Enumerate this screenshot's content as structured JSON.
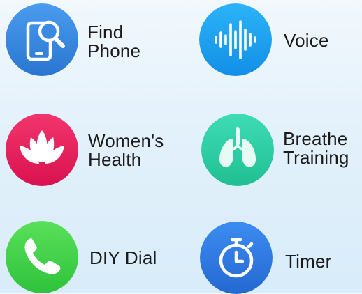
{
  "features": [
    {
      "id": "find-phone",
      "lines": [
        "Find",
        "Phone"
      ],
      "icon": "find-phone-icon",
      "color": "#3a8be0"
    },
    {
      "id": "voice",
      "lines": [
        "Voice"
      ],
      "icon": "voice-wave-icon",
      "color": "#1ba2f2"
    },
    {
      "id": "womens-health",
      "lines": [
        "Women's",
        "Health"
      ],
      "icon": "lotus-icon",
      "color": "#e81d5c"
    },
    {
      "id": "breathe-training",
      "lines": [
        "Breathe",
        "Training"
      ],
      "icon": "lungs-icon",
      "color": "#2fcfa5"
    },
    {
      "id": "diy-dial",
      "lines": [
        "DIY Dial"
      ],
      "icon": "phone-icon",
      "color": "#3fd24a"
    },
    {
      "id": "timer",
      "lines": [
        "Timer"
      ],
      "icon": "stopwatch-icon",
      "color": "#2f7ce0"
    }
  ]
}
